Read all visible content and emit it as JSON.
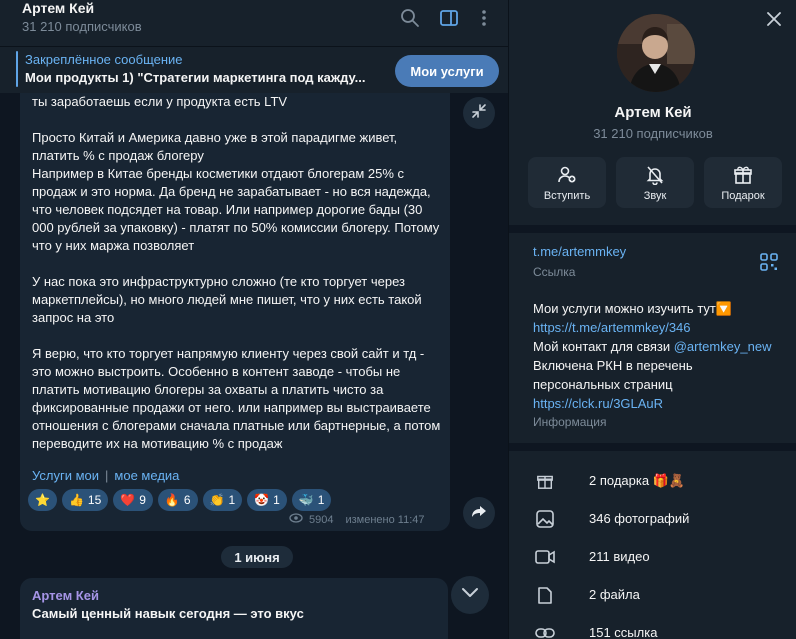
{
  "chat": {
    "title": "Артем Кей",
    "subscribers": "31 210 подписчиков"
  },
  "pinned": {
    "title": "Закреплённое сообщение",
    "text": "Мои продукты  1) \"Стратегии маркетинга под кажду...",
    "button_label": "Мои услуги"
  },
  "message": {
    "body": "ты заработаешь если у продукта есть LTV\n\nПросто Китай и Америка давно уже в этой парадигме живет, платить % с продаж блогеру\nНапример в Китае бренды косметики отдают блогерам 25% с продаж и это норма. Да бренд не зарабатывает - но вся надежда, что человек подсядет на товар. Или например дорогие бады (30 000 рублей за упаковку) - платят по 50% комиссии блогеру. Потому что у них маржа позволяет\n\nУ нас пока это инфраструктурно сложно (те кто торгует через маркетплейсы), но много людей мне пишет, что у них есть такой запрос на это\n\nЯ верю, что кто торгует напрямую клиенту через свой сайт и тд - это можно выстроить. Особенно в контент заводе - чтобы не платить мотивацию блогеры за охваты а платить чисто за фиксированные продажи от него. или например вы выстраиваете отношения с блогерами сначала платные или бартнерные, а потом переводите их на мотивацию % с продаж",
    "link1": "Услуги мои",
    "link_sep": "|",
    "link2": "мое медиа",
    "reactions": [
      {
        "emoji": "⭐",
        "count": ""
      },
      {
        "emoji": "👍",
        "count": "15"
      },
      {
        "emoji": "❤️",
        "count": "9"
      },
      {
        "emoji": "🔥",
        "count": "6"
      },
      {
        "emoji": "👏",
        "count": "1"
      },
      {
        "emoji": "🤡",
        "count": "1"
      },
      {
        "emoji": "🐳",
        "count": "1"
      }
    ],
    "views": "5904",
    "edited": "изменено 11:47"
  },
  "date_separator": "1 июня",
  "next_message": {
    "author": "Артем Кей",
    "text": "Самый ценный навык сегодня — это вкус"
  },
  "profile": {
    "name": "Артем Кей",
    "subscribers": "31 210 подписчиков",
    "actions": {
      "join": "Вступить",
      "sound": "Звук",
      "gift": "Подарок"
    },
    "link": "t.me/artemmkey",
    "link_label": "Ссылка",
    "bio_line1": "Мои услуги можно изучить тут🔽",
    "bio_link1": "https://t.me/artemmkey/346",
    "bio_line2_prefix": "Мой контакт для связи ",
    "bio_mention": "@artemkey_new",
    "bio_line3": "Включена РКН в перечень персональных страниц",
    "bio_link2": "https://clck.ru/3GLAuR",
    "bio_label": "Информация",
    "media": {
      "gifts": "2 подарка 🎁🧸",
      "photos": "346 фотографий",
      "videos": "211 видео",
      "files": "2 файла",
      "links": "151 ссылка"
    }
  },
  "colors": {
    "background": "#0e1621",
    "panel": "#17212b",
    "bubble": "#182533",
    "accent": "#6ab3f3",
    "button": "#4a7bb7",
    "reaction": "#2b5278"
  }
}
